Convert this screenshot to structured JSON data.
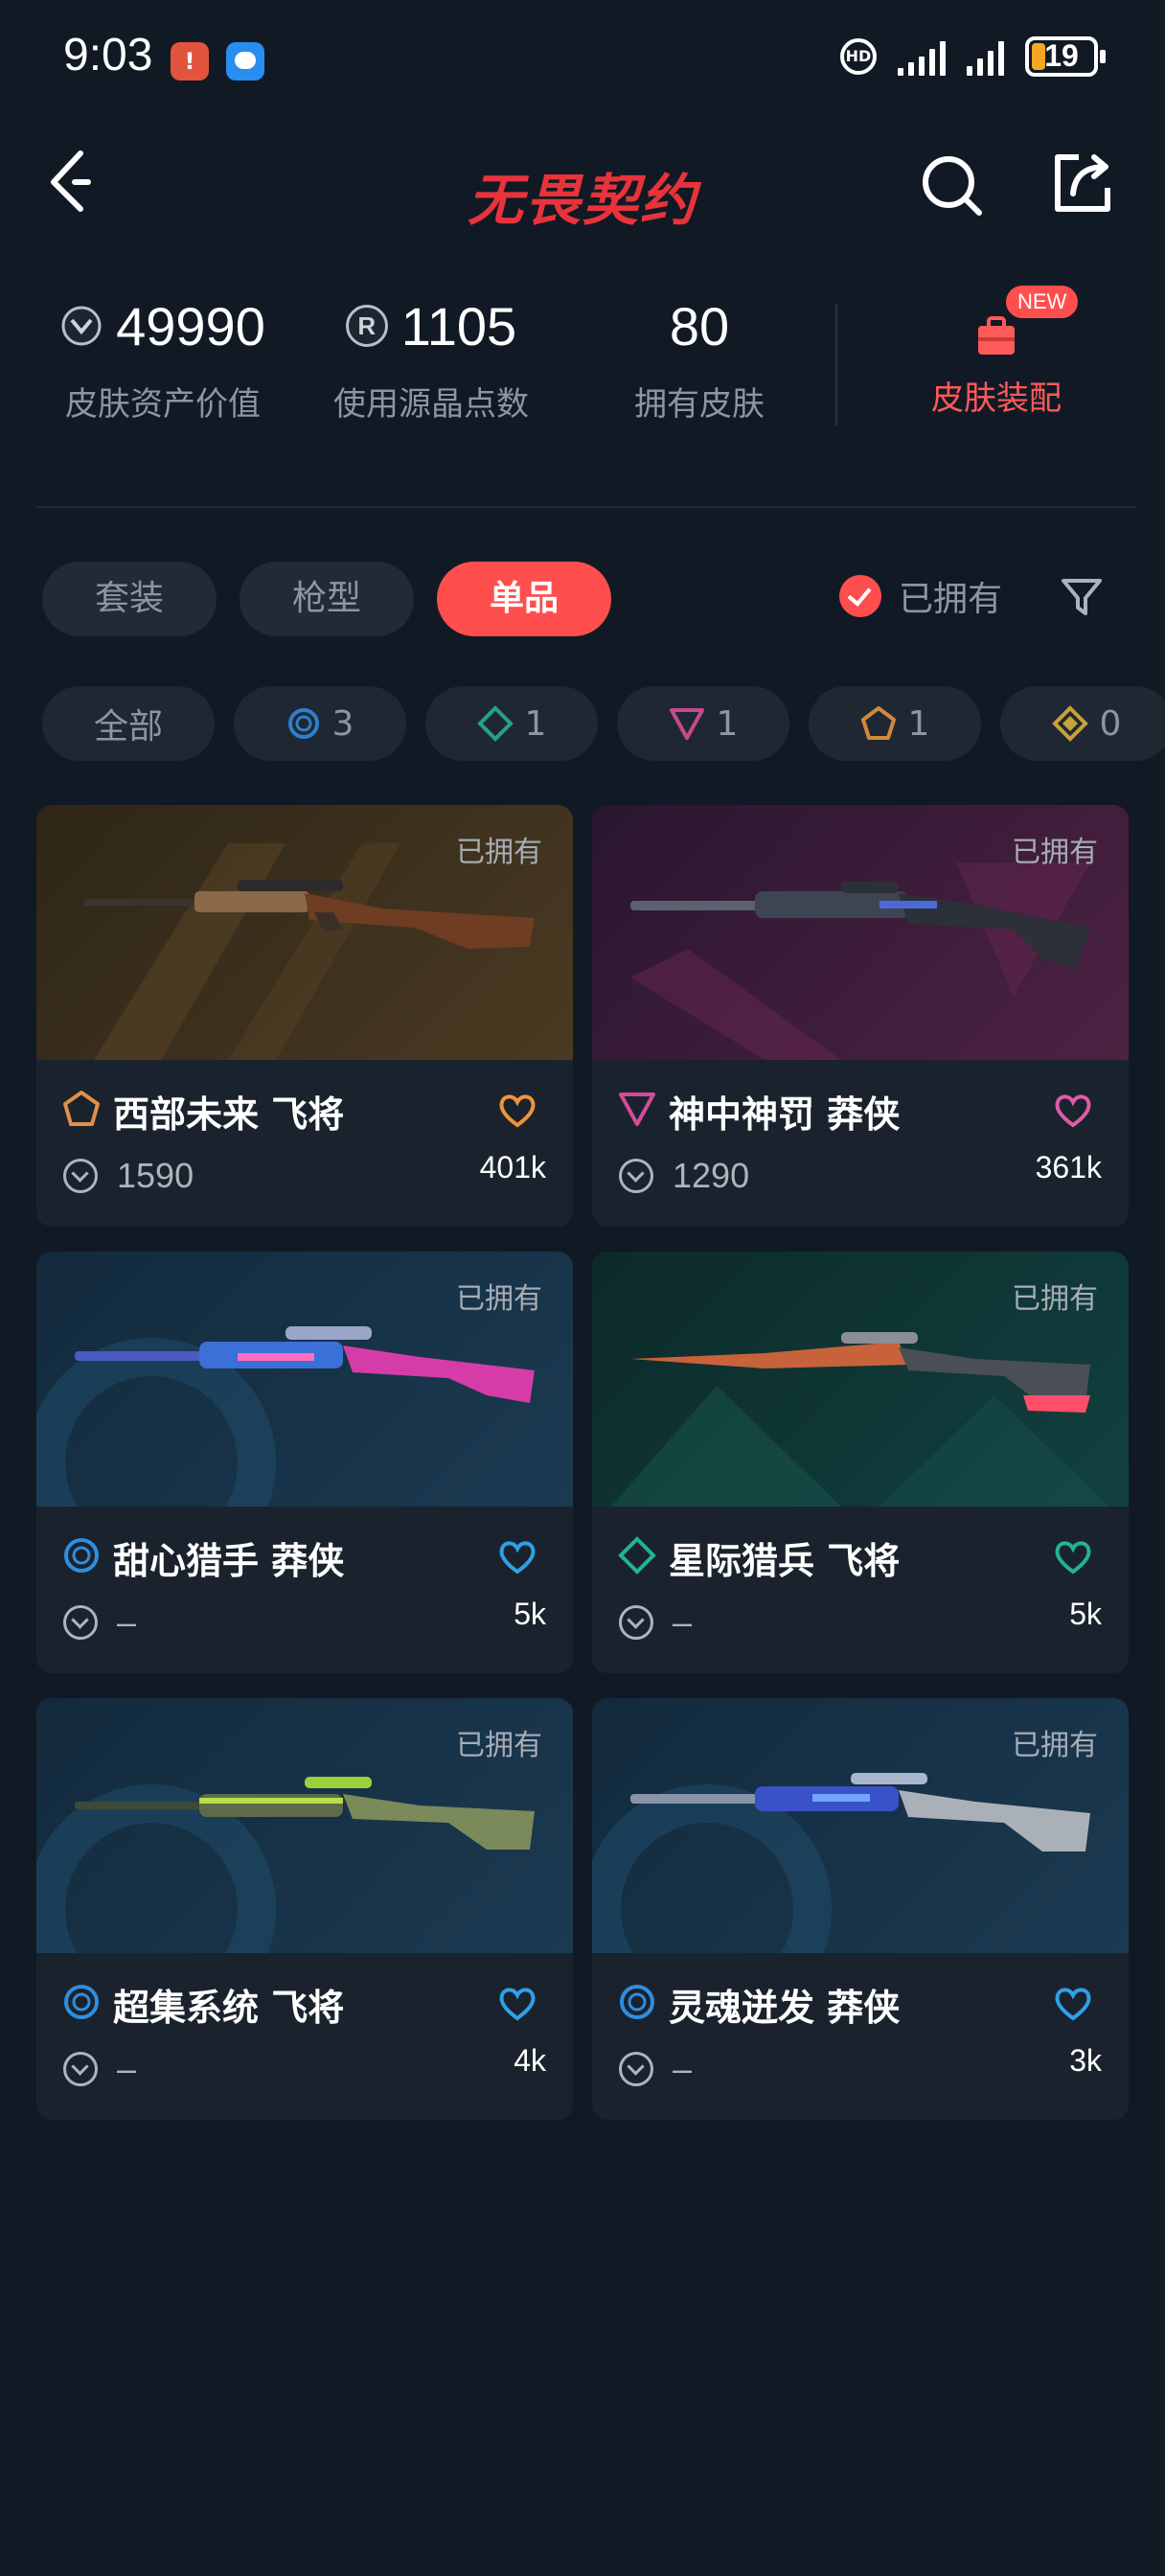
{
  "status": {
    "time": "9:03",
    "app_badge": "!",
    "hd": "HD",
    "battery": "19"
  },
  "header": {
    "title": "无畏契约"
  },
  "stats": {
    "asset_value": "49990",
    "asset_label": "皮肤资产价值",
    "radianite": "1105",
    "radianite_label": "使用源晶点数",
    "owned": "80",
    "owned_label": "拥有皮肤",
    "equip_badge": "NEW",
    "equip_label": "皮肤装配",
    "radianite_icon": "R"
  },
  "tabs": [
    {
      "label": "套装"
    },
    {
      "label": "枪型"
    },
    {
      "label": "单品"
    }
  ],
  "owned_toggle": {
    "label": "已拥有"
  },
  "chips": [
    {
      "label": "全部"
    },
    {
      "count": "3",
      "color": "#2f7fd0"
    },
    {
      "count": "1",
      "color": "#22a28a"
    },
    {
      "count": "1",
      "color": "#c64a8f"
    },
    {
      "count": "1",
      "color": "#d08a3b"
    },
    {
      "count": "0",
      "color": "#c9a13b"
    }
  ],
  "cards": [
    {
      "owned": "已拥有",
      "name": "西部未来 飞将",
      "price": "1590",
      "likes": "401k",
      "rarity_color": "#e0904a",
      "heart_color": "#f0933d",
      "bg": "#3b3020"
    },
    {
      "owned": "已拥有",
      "name": "神中神罚 莽侠",
      "price": "1290",
      "likes": "361k",
      "rarity_color": "#d24c98",
      "heart_color": "#e05aa6",
      "bg": "#3d1f3a"
    },
    {
      "owned": "已拥有",
      "name": "甜心猎手 莽侠",
      "price": "–",
      "likes": "5k",
      "rarity_color": "#2e8ee0",
      "heart_color": "#2fa0e8",
      "bg": "#173247"
    },
    {
      "owned": "已拥有",
      "name": "星际猎兵 飞将",
      "price": "–",
      "likes": "5k",
      "rarity_color": "#22b394",
      "heart_color": "#22b394",
      "bg": "#0f3433"
    },
    {
      "owned": "已拥有",
      "name": "超集系统 飞将",
      "price": "–",
      "likes": "4k",
      "rarity_color": "#2e8ee0",
      "heart_color": "#2fa0e8",
      "bg": "#173247"
    },
    {
      "owned": "已拥有",
      "name": "灵魂迸发 莽侠",
      "price": "–",
      "likes": "3k",
      "rarity_color": "#2e8ee0",
      "heart_color": "#2fa0e8",
      "bg": "#173247"
    }
  ]
}
